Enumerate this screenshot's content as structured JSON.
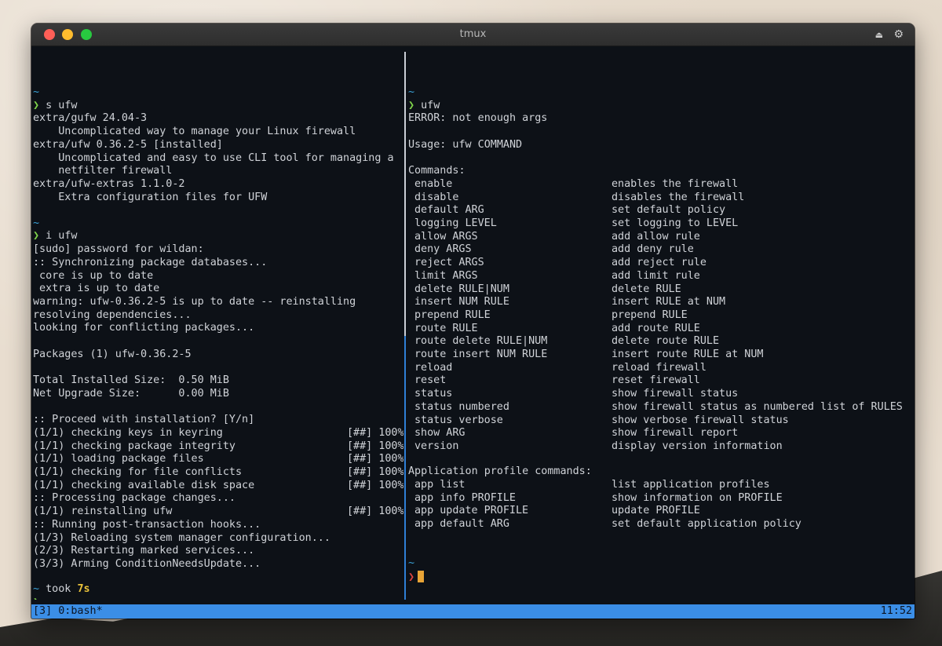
{
  "window": {
    "title": "tmux",
    "eject_icon": "eject-icon",
    "gear_icon": "gear-icon"
  },
  "left_pane": {
    "tilde": "~",
    "prompt_symbol": "❯",
    "cmd1": " s ufw",
    "search_results": [
      "extra/gufw 24.04-3",
      "    Uncomplicated way to manage your Linux firewall",
      "extra/ufw 0.36.2-5 [installed]",
      "    Uncomplicated and easy to use CLI tool for managing a",
      "    netfilter firewall",
      "extra/ufw-extras 1.1.0-2",
      "    Extra configuration files for UFW"
    ],
    "cmd2": " i ufw",
    "install_output": [
      "[sudo] password for wildan:",
      ":: Synchronizing package databases...",
      " core is up to date",
      " extra is up to date",
      "warning: ufw-0.36.2-5 is up to date -- reinstalling",
      "resolving dependencies...",
      "looking for conflicting packages...",
      "",
      "Packages (1) ufw-0.36.2-5",
      "",
      "Total Installed Size:  0.50 MiB",
      "Net Upgrade Size:      0.00 MiB",
      "",
      ":: Proceed with installation? [Y/n]"
    ],
    "progress": [
      {
        "label": "(1/1) checking keys in keyring",
        "bar": "[##] 100%"
      },
      {
        "label": "(1/1) checking package integrity",
        "bar": "[##] 100%"
      },
      {
        "label": "(1/1) loading package files",
        "bar": "[##] 100%"
      },
      {
        "label": "(1/1) checking for file conflicts",
        "bar": "[##] 100%"
      },
      {
        "label": "(1/1) checking available disk space",
        "bar": "[##] 100%"
      },
      {
        "label": ":: Processing package changes...",
        "bar": ""
      },
      {
        "label": "(1/1) reinstalling ufw",
        "bar": "[##] 100%"
      },
      {
        "label": ":: Running post-transaction hooks...",
        "bar": ""
      },
      {
        "label": "(1/3) Reloading system manager configuration...",
        "bar": ""
      },
      {
        "label": "(2/3) Restarting marked services...",
        "bar": ""
      },
      {
        "label": "(3/3) Arming ConditionNeedsUpdate...",
        "bar": ""
      }
    ],
    "took_prefix": " took ",
    "took_value": "7s"
  },
  "right_pane": {
    "tilde": "~",
    "prompt_symbol": "❯",
    "cmd": " ufw",
    "error": "ERROR: not enough args",
    "usage": "Usage: ufw COMMAND",
    "commands_header": "Commands:",
    "commands": [
      {
        "cmd": "enable",
        "desc": "enables the firewall"
      },
      {
        "cmd": "disable",
        "desc": "disables the firewall"
      },
      {
        "cmd": "default ARG",
        "desc": "set default policy"
      },
      {
        "cmd": "logging LEVEL",
        "desc": "set logging to LEVEL"
      },
      {
        "cmd": "allow ARGS",
        "desc": "add allow rule"
      },
      {
        "cmd": "deny ARGS",
        "desc": "add deny rule"
      },
      {
        "cmd": "reject ARGS",
        "desc": "add reject rule"
      },
      {
        "cmd": "limit ARGS",
        "desc": "add limit rule"
      },
      {
        "cmd": "delete RULE|NUM",
        "desc": "delete RULE"
      },
      {
        "cmd": "insert NUM RULE",
        "desc": "insert RULE at NUM"
      },
      {
        "cmd": "prepend RULE",
        "desc": "prepend RULE"
      },
      {
        "cmd": "route RULE",
        "desc": "add route RULE"
      },
      {
        "cmd": "route delete RULE|NUM",
        "desc": "delete route RULE"
      },
      {
        "cmd": "route insert NUM RULE",
        "desc": "insert route RULE at NUM"
      },
      {
        "cmd": "reload",
        "desc": "reload firewall"
      },
      {
        "cmd": "reset",
        "desc": "reset firewall"
      },
      {
        "cmd": "status",
        "desc": "show firewall status"
      },
      {
        "cmd": "status numbered",
        "desc": "show firewall status as numbered list of RULES"
      },
      {
        "cmd": "status verbose",
        "desc": "show verbose firewall status"
      },
      {
        "cmd": "show ARG",
        "desc": "show firewall report"
      },
      {
        "cmd": "version",
        "desc": "display version information"
      }
    ],
    "app_header": "Application profile commands:",
    "app_commands": [
      {
        "cmd": "app list",
        "desc": "list application profiles"
      },
      {
        "cmd": "app info PROFILE",
        "desc": "show information on PROFILE"
      },
      {
        "cmd": "app update PROFILE",
        "desc": "update PROFILE"
      },
      {
        "cmd": "app default ARG",
        "desc": "set default application policy"
      }
    ]
  },
  "statusbar": {
    "left": "[3] 0:bash*",
    "right": "11:52"
  },
  "colors": {
    "accent": "#3b8ee6",
    "prompt_ok": "#7fd34a",
    "prompt_err": "#e0443f",
    "tilde": "#3aa3d8",
    "duration": "#e9c23b"
  }
}
